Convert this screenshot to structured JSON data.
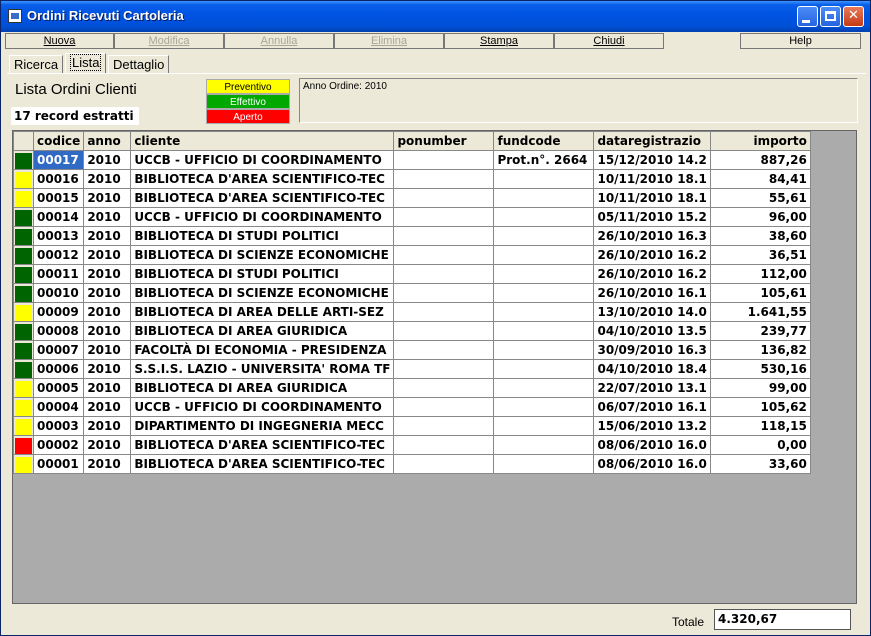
{
  "window": {
    "title": "Ordini Ricevuti Cartoleria",
    "icon": "app-icon"
  },
  "toolbar": {
    "buttons": [
      {
        "label": "Nuova",
        "enabled": true
      },
      {
        "label": "Modifica",
        "enabled": false
      },
      {
        "label": "Annulla",
        "enabled": false
      },
      {
        "label": "Elimina",
        "enabled": false
      },
      {
        "label": "Stampa",
        "enabled": true
      },
      {
        "label": "Chiudi",
        "enabled": true
      },
      {
        "label": "Help",
        "enabled": true
      }
    ]
  },
  "tabs": [
    {
      "label": "Ricerca",
      "active": false
    },
    {
      "label": "Lista",
      "active": true
    },
    {
      "label": "Dettaglio",
      "active": false
    }
  ],
  "header": {
    "title": "Lista Ordini Clienti",
    "record_count": "17 record estratti",
    "anno_filter": "Anno Ordine: 2010"
  },
  "legend": [
    {
      "label": "Preventivo",
      "color": "#FFFF00",
      "text_color": "#000000"
    },
    {
      "label": "Effettivo",
      "color": "#00A800",
      "text_color": "#FFFFFF"
    },
    {
      "label": "Aperto",
      "color": "#FF0000",
      "text_color": "#FFFFFF"
    }
  ],
  "status_colors": {
    "preventivo": "#FFFF00",
    "effettivo": "#006400",
    "aperto": "#FF0000"
  },
  "grid": {
    "columns": [
      "codice",
      "anno",
      "cliente",
      "ponumber",
      "fundcode",
      "dataregistrazio",
      "importo"
    ],
    "rows": [
      {
        "status": "effettivo",
        "codice": "00017",
        "anno": "2010",
        "cliente": "UCCB - UFFICIO DI COORDINAMENTO",
        "ponumber": "",
        "fundcode": "Prot.n°. 2664",
        "data": "15/12/2010 14.2",
        "importo": "887,26",
        "selected": true
      },
      {
        "status": "preventivo",
        "codice": "00016",
        "anno": "2010",
        "cliente": "BIBLIOTECA D'AREA SCIENTIFICO-TEC",
        "ponumber": "",
        "fundcode": "",
        "data": "10/11/2010 18.1",
        "importo": "84,41"
      },
      {
        "status": "preventivo",
        "codice": "00015",
        "anno": "2010",
        "cliente": "BIBLIOTECA D'AREA SCIENTIFICO-TEC",
        "ponumber": "",
        "fundcode": "",
        "data": "10/11/2010 18.1",
        "importo": "55,61"
      },
      {
        "status": "effettivo",
        "codice": "00014",
        "anno": "2010",
        "cliente": "UCCB - UFFICIO DI COORDINAMENTO",
        "ponumber": "",
        "fundcode": "",
        "data": "05/11/2010 15.2",
        "importo": "96,00"
      },
      {
        "status": "effettivo",
        "codice": "00013",
        "anno": "2010",
        "cliente": "BIBLIOTECA DI STUDI POLITICI",
        "ponumber": "",
        "fundcode": "",
        "data": "26/10/2010 16.3",
        "importo": "38,60"
      },
      {
        "status": "effettivo",
        "codice": "00012",
        "anno": "2010",
        "cliente": "BIBLIOTECA DI SCIENZE ECONOMICHE",
        "ponumber": "",
        "fundcode": "",
        "data": "26/10/2010 16.2",
        "importo": "36,51"
      },
      {
        "status": "effettivo",
        "codice": "00011",
        "anno": "2010",
        "cliente": "BIBLIOTECA DI STUDI POLITICI",
        "ponumber": "",
        "fundcode": "",
        "data": "26/10/2010 16.2",
        "importo": "112,00"
      },
      {
        "status": "effettivo",
        "codice": "00010",
        "anno": "2010",
        "cliente": "BIBLIOTECA DI SCIENZE ECONOMICHE",
        "ponumber": "",
        "fundcode": "",
        "data": "26/10/2010 16.1",
        "importo": "105,61"
      },
      {
        "status": "preventivo",
        "codice": "00009",
        "anno": "2010",
        "cliente": "BIBLIOTECA DI AREA DELLE ARTI-SEZ",
        "ponumber": "",
        "fundcode": "",
        "data": "13/10/2010 14.0",
        "importo": "1.641,55"
      },
      {
        "status": "effettivo",
        "codice": "00008",
        "anno": "2010",
        "cliente": "BIBLIOTECA DI AREA GIURIDICA",
        "ponumber": "",
        "fundcode": "",
        "data": "04/10/2010 13.5",
        "importo": "239,77"
      },
      {
        "status": "effettivo",
        "codice": "00007",
        "anno": "2010",
        "cliente": "FACOLTÀ DI ECONOMIA - PRESIDENZA",
        "ponumber": "",
        "fundcode": "",
        "data": "30/09/2010 16.3",
        "importo": "136,82"
      },
      {
        "status": "effettivo",
        "codice": "00006",
        "anno": "2010",
        "cliente": "S.S.I.S. LAZIO - UNIVERSITA' ROMA TF",
        "ponumber": "",
        "fundcode": "",
        "data": "04/10/2010 18.4",
        "importo": "530,16"
      },
      {
        "status": "preventivo",
        "codice": "00005",
        "anno": "2010",
        "cliente": "BIBLIOTECA DI AREA GIURIDICA",
        "ponumber": "",
        "fundcode": "",
        "data": "22/07/2010 13.1",
        "importo": "99,00"
      },
      {
        "status": "preventivo",
        "codice": "00004",
        "anno": "2010",
        "cliente": "UCCB - UFFICIO DI COORDINAMENTO",
        "ponumber": "",
        "fundcode": "",
        "data": "06/07/2010 16.1",
        "importo": "105,62"
      },
      {
        "status": "preventivo",
        "codice": "00003",
        "anno": "2010",
        "cliente": "DIPARTIMENTO DI INGEGNERIA MECC",
        "ponumber": "",
        "fundcode": "",
        "data": "15/06/2010 13.2",
        "importo": "118,15"
      },
      {
        "status": "aperto",
        "codice": "00002",
        "anno": "2010",
        "cliente": "BIBLIOTECA D'AREA SCIENTIFICO-TEC",
        "ponumber": "",
        "fundcode": "",
        "data": "08/06/2010 16.0",
        "importo": "0,00"
      },
      {
        "status": "preventivo",
        "codice": "00001",
        "anno": "2010",
        "cliente": "BIBLIOTECA D'AREA SCIENTIFICO-TEC",
        "ponumber": "",
        "fundcode": "",
        "data": "08/06/2010 16.0",
        "importo": "33,60"
      }
    ]
  },
  "footer": {
    "total_label": "Totale",
    "total_value": "4.320,67"
  }
}
